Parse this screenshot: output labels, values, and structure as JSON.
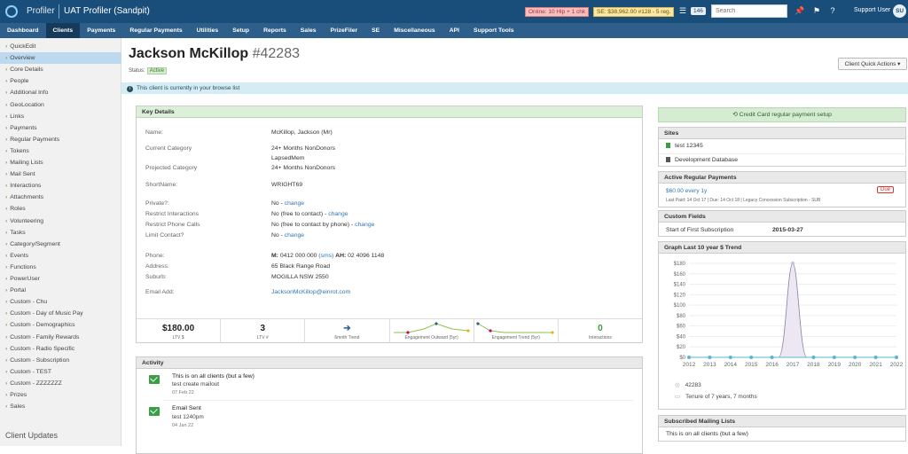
{
  "topbar": {
    "app_name": "Profiler",
    "org_name": "UAT Profiler (Sandpit)",
    "online_badge": "Online: 10 Hlp + 1 chk",
    "se_badge": "SE: $38,962.00 #128 - 5 reg.",
    "count": "146",
    "search_placeholder": "Search",
    "user_label": "Support User",
    "avatar": "SU"
  },
  "nav": [
    "Dashboard",
    "Clients",
    "Payments",
    "Regular Payments",
    "Utilities",
    "Setup",
    "Reports",
    "Sales",
    "PrizeFiler",
    "SE",
    "Miscellaneous",
    "API",
    "Support Tools"
  ],
  "sidebar": {
    "items": [
      "QuickEdit",
      "Overview",
      "Core Details",
      "People",
      "Additional Info",
      "GeoLocation",
      "Links",
      "Payments",
      "Regular Payments",
      "Tokens",
      "Mailing Lists",
      "Mail Sent",
      "Interactions",
      "Attachments",
      "Roles",
      "Volunteering",
      "Tasks",
      "Category/Segment",
      "Events",
      "Functions",
      "PowerUser",
      "Portal",
      "Custom - Chu",
      "Custom - Day of Music Pay",
      "Custom - Demographics",
      "Custom - Family Rewards",
      "Custom - Radio Specific",
      "Custom - Subscription",
      "Custom - TEST",
      "Custom - ZZZZZZZ",
      "Prizes",
      "Sales"
    ],
    "footer": "Client Updates"
  },
  "client": {
    "name": "Jackson McKillop",
    "id": "#42283",
    "status_label": "Status:",
    "status": "Active",
    "quick_actions": "Client Quick Actions ▾",
    "browse_notice": "This client is currently in your browse list"
  },
  "key_details": {
    "title": "Key Details",
    "rows": [
      {
        "label": "Name:",
        "value": "McKillop, Jackson (Mr)"
      },
      {
        "label": "Current Category",
        "value": "24+ Months NonDonors",
        "value2": "LapsedMem"
      },
      {
        "label": "Projected Category",
        "value": "24+ Months NonDonors"
      },
      {
        "label": "ShortName:",
        "value": "WRIGHT69"
      },
      {
        "label": "Private?:",
        "value": "No - ",
        "link": "change"
      },
      {
        "label": "Restrict Interactions",
        "value": "No (free to contact) - ",
        "link": "change"
      },
      {
        "label": "Restrict Phone Calls",
        "value": "No (free to contact by phone) - ",
        "link": "change"
      },
      {
        "label": "Limit Contact?",
        "value": "No - ",
        "link": "change"
      },
      {
        "label": "Phone:",
        "m": "M:",
        "value": "0412 000 000",
        "sms": "(sms)",
        "ah": "AH:",
        "value2": "02 4096 1148"
      },
      {
        "label": "Address:",
        "value": "65 Black Range Road"
      },
      {
        "label": "Suburb:",
        "value": "MOGILLA NSW 2550"
      },
      {
        "label": "Email Add:",
        "link": "JacksonMcKillop@einrot.com"
      }
    ],
    "stats": [
      {
        "value": "$180.00",
        "label": "LTV $"
      },
      {
        "value": "3",
        "label": "LTV #"
      },
      {
        "icon": "arrow-right-icon",
        "label": "6mnth Trend"
      },
      {
        "label": "Engagement Outward (5yr)"
      },
      {
        "label": "Engagement Trend (5yr)"
      },
      {
        "value": "0",
        "label": "Interactions"
      }
    ]
  },
  "activity": {
    "title": "Activity",
    "items": [
      {
        "title": "This is on all clients (but a few)",
        "sub": "test create mailout",
        "date": "07 Feb 22"
      },
      {
        "title": "Email Sent",
        "sub": "test 1240pm",
        "date": "04 Jan 22"
      }
    ]
  },
  "right": {
    "cc_button": "Credit Card regular payment setup",
    "sites": {
      "title": "Sites",
      "items": [
        "test 12345",
        "Development Database"
      ]
    },
    "arp": {
      "title": "Active Regular Payments",
      "amount": "$60.00 every 1y",
      "detail": "Last Paid: 14 Oct 17 | Due: 14 Oct 18 | Legacy Concession Subscription - SUB",
      "due": "Due"
    },
    "custom": {
      "title": "Custom Fields",
      "label": "Start of First Subscription",
      "value": "2015-03-27"
    },
    "graph": {
      "title": "Graph Last 10 year $ Trend",
      "id": "42283",
      "tenure": "Tenure of 7 years, 7 months"
    },
    "mailing": {
      "title": "Subscribed Mailing Lists",
      "item": "This is on all clients (but a few)"
    }
  },
  "chart_data": {
    "type": "area",
    "x": [
      "2012",
      "2013",
      "2014",
      "2015",
      "2016",
      "2017",
      "2018",
      "2019",
      "2020",
      "2021",
      "2022"
    ],
    "values": [
      0,
      0,
      0,
      0,
      0,
      180,
      0,
      0,
      0,
      0,
      0
    ],
    "ylim": [
      0,
      180
    ],
    "yticks": [
      "$0",
      "$20",
      "$40",
      "$60",
      "$80",
      "$100",
      "$120",
      "$140",
      "$160",
      "$180"
    ],
    "grid": true
  }
}
